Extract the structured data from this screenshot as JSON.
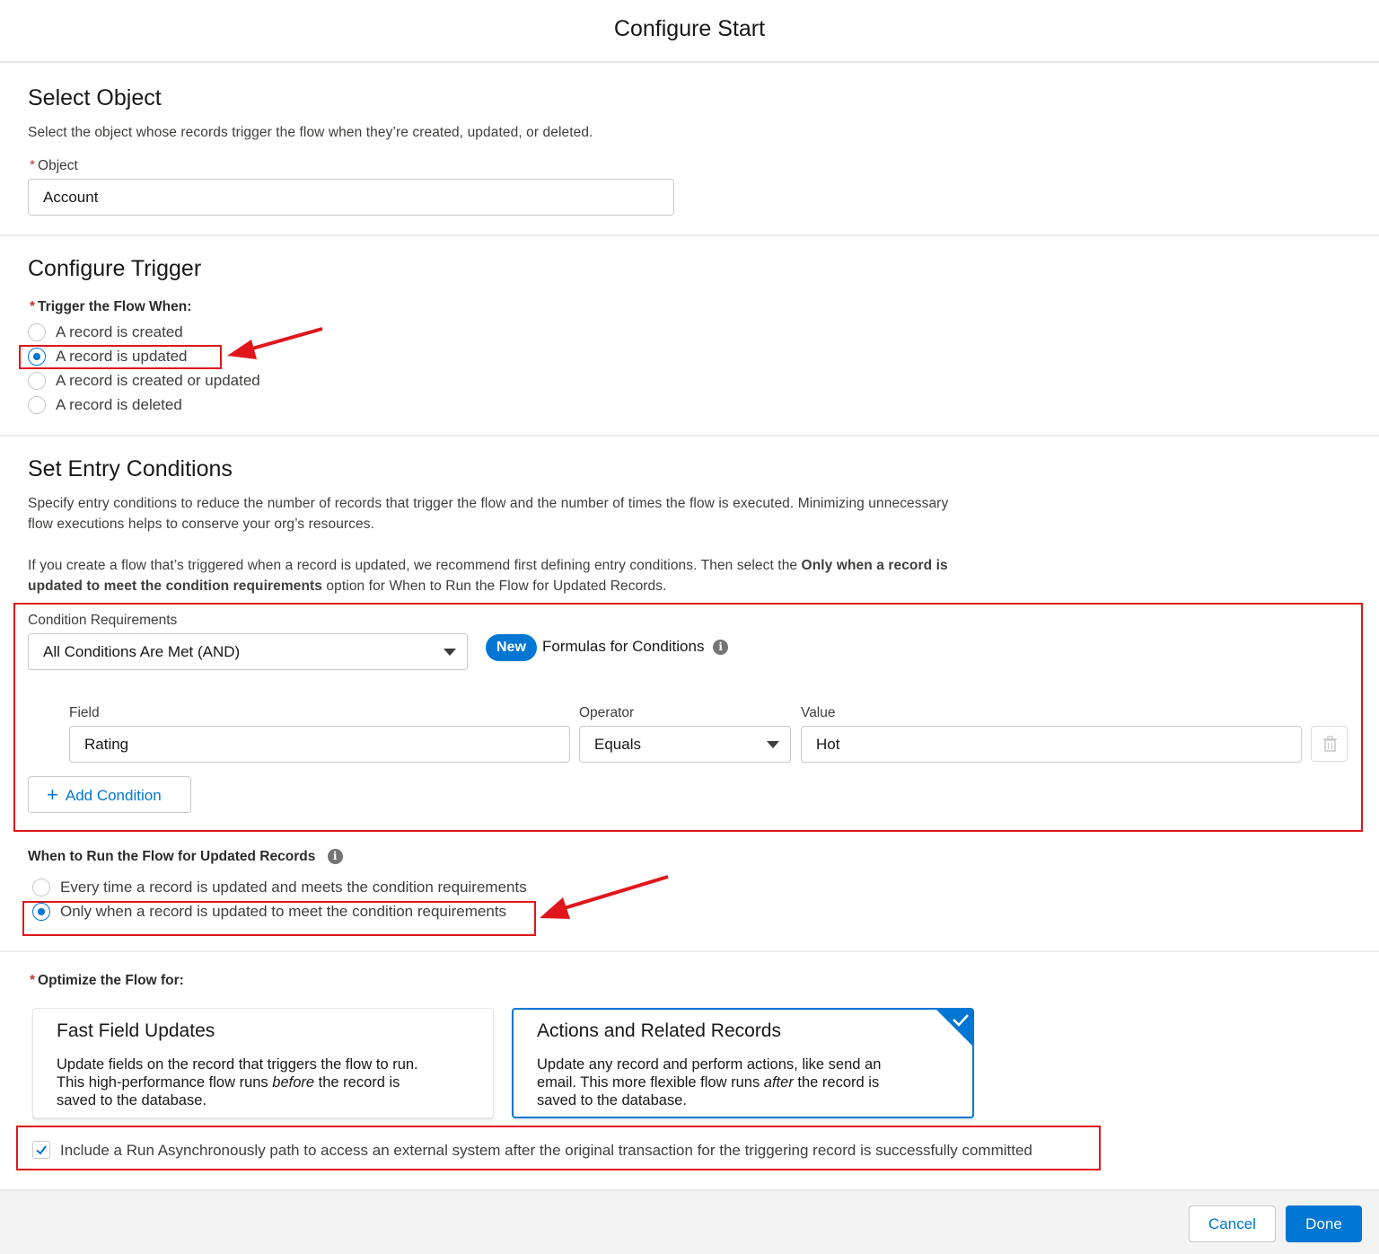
{
  "modal": {
    "title": "Configure Start"
  },
  "select_object": {
    "heading": "Select Object",
    "description": "Select the object whose records trigger the flow when they’re created, updated, or deleted.",
    "required_mark": "*",
    "object_label": "Object",
    "object_value": "Account"
  },
  "configure_trigger": {
    "heading": "Configure Trigger",
    "required_mark": "*",
    "trigger_label": "Trigger the Flow When:",
    "options": [
      {
        "label": "A record is created",
        "selected": false
      },
      {
        "label": "A record is updated",
        "selected": true
      },
      {
        "label": "A record is created or updated",
        "selected": false
      },
      {
        "label": "A record is deleted",
        "selected": false
      }
    ]
  },
  "entry_conditions": {
    "heading": "Set Entry Conditions",
    "description_1": "Specify entry conditions to reduce the number of records that trigger the flow and the number of times the flow is executed. Minimizing unnecessary",
    "description_2": "flow executions helps to conserve your org’s resources.",
    "rec_part1": "If you create a flow that’s triggered when a record is updated, we recommend first defining entry conditions. Then select the ",
    "rec_bold1": "Only when a record is",
    "rec_bold2": "updated to meet the condition requirements",
    "rec_part2": " option for When to Run the Flow for Updated Records.",
    "condition_requirements_label": "Condition Requirements",
    "condition_requirements_value": "All Conditions Are Met (AND)",
    "new_badge": "New",
    "formulas_label": "Formulas for Conditions",
    "info_glyph": "i",
    "columns": {
      "field": "Field",
      "operator": "Operator",
      "value": "Value"
    },
    "condition": {
      "field": "Rating",
      "operator": "Equals",
      "value": "Hot"
    },
    "add_condition_icon": "+",
    "add_condition_label": "Add Condition"
  },
  "when_to_run": {
    "label": "When to Run the Flow for Updated Records",
    "info_glyph": "i",
    "options": [
      {
        "label": "Every time a record is updated and meets the condition requirements",
        "selected": false
      },
      {
        "label": "Only when a record is updated to meet the condition requirements",
        "selected": true
      }
    ]
  },
  "optimize": {
    "required_mark": "*",
    "label": "Optimize the Flow for:",
    "cards": [
      {
        "title": "Fast Field Updates",
        "line1": "Update fields on the record that triggers the flow to run.",
        "line2a": "This high-performance flow runs ",
        "line2em": "before",
        "line2b": " the record is",
        "line3": "saved to the database.",
        "selected": false
      },
      {
        "title": "Actions and Related Records",
        "line1": "Update any record and perform actions, like send an",
        "line2a": "email. This more flexible flow runs ",
        "line2em": "after",
        "line2b": " the record is",
        "line3": "saved to the database.",
        "selected": true
      }
    ]
  },
  "async": {
    "checked": true,
    "label": "Include a Run Asynchronously path to access an external system after the original transaction for the triggering record is successfully committed"
  },
  "footer": {
    "cancel": "Cancel",
    "done": "Done"
  },
  "colors": {
    "brand": "#0176d3",
    "annotation_red": "#e0161c",
    "required": "#c23934"
  }
}
